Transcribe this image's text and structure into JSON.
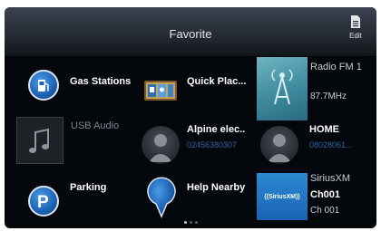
{
  "header": {
    "title": "Favorite",
    "edit_label": "Edit"
  },
  "tiles": [
    {
      "label": "Gas Stations",
      "icon": "gas-pump-icon"
    },
    {
      "label": "Quick Plac...",
      "icon": "quick-places-icon"
    },
    {
      "label": "Radio FM 1",
      "sub": "87.7MHz",
      "icon": "radio-antenna-icon"
    },
    {
      "label": "USB Audio",
      "icon": "music-note-icon"
    },
    {
      "label": "Alpine elec..",
      "sub": "02456380307",
      "icon": "person-avatar-icon"
    },
    {
      "label": "HOME",
      "sub": "08028061...",
      "icon": "person-avatar-icon"
    },
    {
      "label": "Parking",
      "icon": "parking-icon"
    },
    {
      "label": "Help Nearby",
      "icon": "map-pin-icon"
    },
    {
      "label": "SiriusXM",
      "sub": "Ch001",
      "sub2": "Ch 001",
      "logo": "((SiriusXM))",
      "icon": "siriusxm-logo"
    }
  ],
  "pagination": {
    "pages": 3,
    "current": 1
  },
  "colors": {
    "background": "#04080d",
    "accent_blue": "#1b62b4",
    "phone_number": "#2d64a0",
    "dim_label": "#7d8590"
  }
}
